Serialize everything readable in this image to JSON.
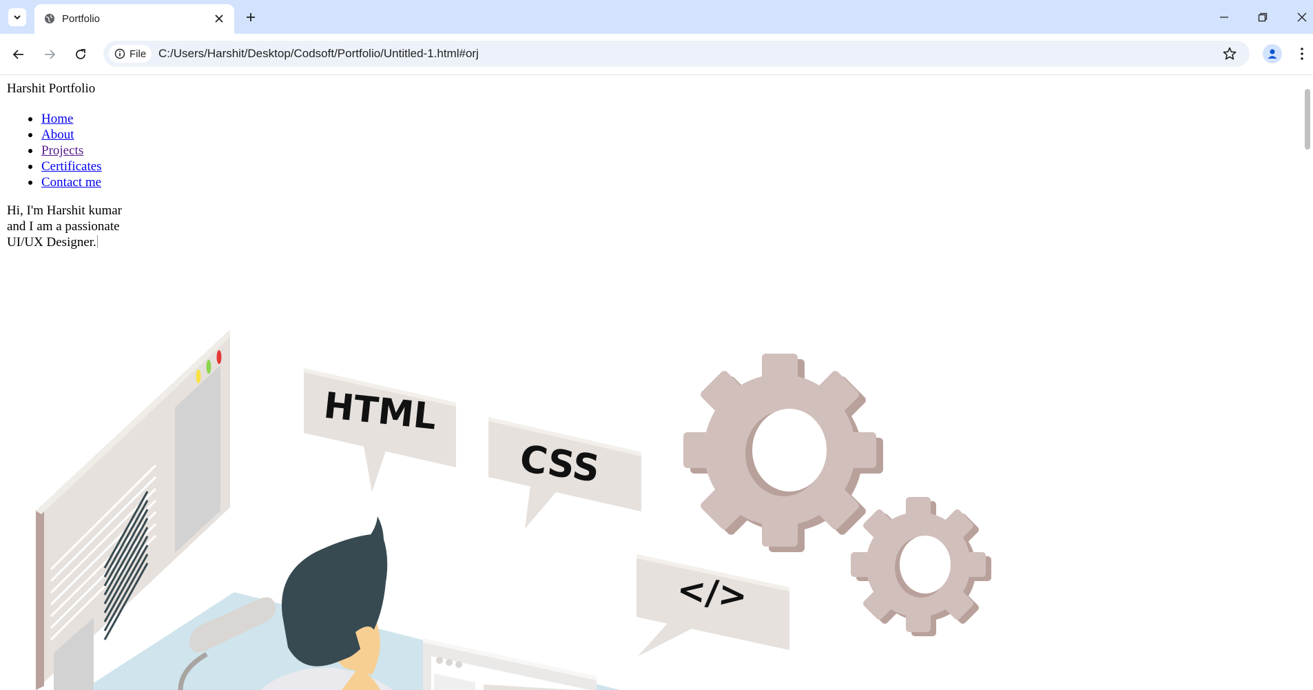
{
  "browser": {
    "tab_title": "Portfolio",
    "address_chip": "File",
    "url": "C:/Users/Harshit/Desktop/Codsoft/Portfolio/Untitled-1.html#orj",
    "icons": [
      "tab-list-icon",
      "globe-icon",
      "close-icon",
      "plus-icon",
      "minimize-icon",
      "restore-icon",
      "window-close-icon",
      "back-icon",
      "forward-icon",
      "reload-icon",
      "info-icon",
      "star-icon",
      "profile-icon",
      "more-menu-icon"
    ]
  },
  "page": {
    "brand": "Harshit Portfolio",
    "nav": [
      {
        "label": "Home"
      },
      {
        "label": "About"
      },
      {
        "label": "Projects"
      },
      {
        "label": "Certificates"
      },
      {
        "label": "Contact me"
      }
    ],
    "hero_text": "Hi, I'm Harshit kumar and I am a passionate UI/UX Designer.",
    "illustration": {
      "bubbles": [
        "HTML",
        "CSS",
        "</>"
      ],
      "colors": {
        "panel": "#e6e1dd",
        "gear": "#d1bfbb",
        "gear_shadow": "#b9a19b",
        "hair": "#384a51",
        "skin": "#f7cf93",
        "desk": "#cfe4ec"
      }
    }
  }
}
